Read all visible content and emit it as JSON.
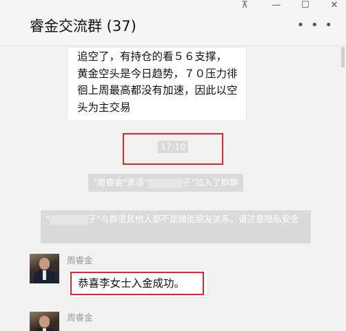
{
  "window": {
    "title": "睿金交流群 (37)",
    "controls": {
      "pin": "⊼",
      "minimize": "—",
      "maximize": "☐",
      "close": "✕"
    },
    "more": "• • •"
  },
  "messages": {
    "top_bubble_text": "追空了，有持仓的看５６支撑，　黄金空头是今日趋势，７０压力徘徊上周最高都没有加速，因此以空头为主交易",
    "timestamp": "17:10",
    "system1_prefix": "\"周睿金\"邀请\"",
    "system1_suffix": "子\"加入了群聊",
    "system2_prefix": "\"",
    "system2_suffix": "子\"与群里其他人都不是微信朋友关系，请注意隐私安全",
    "sender1": "周睿金",
    "bubble2_text": "恭喜李女士入金成功。",
    "sender2": "周睿金"
  }
}
